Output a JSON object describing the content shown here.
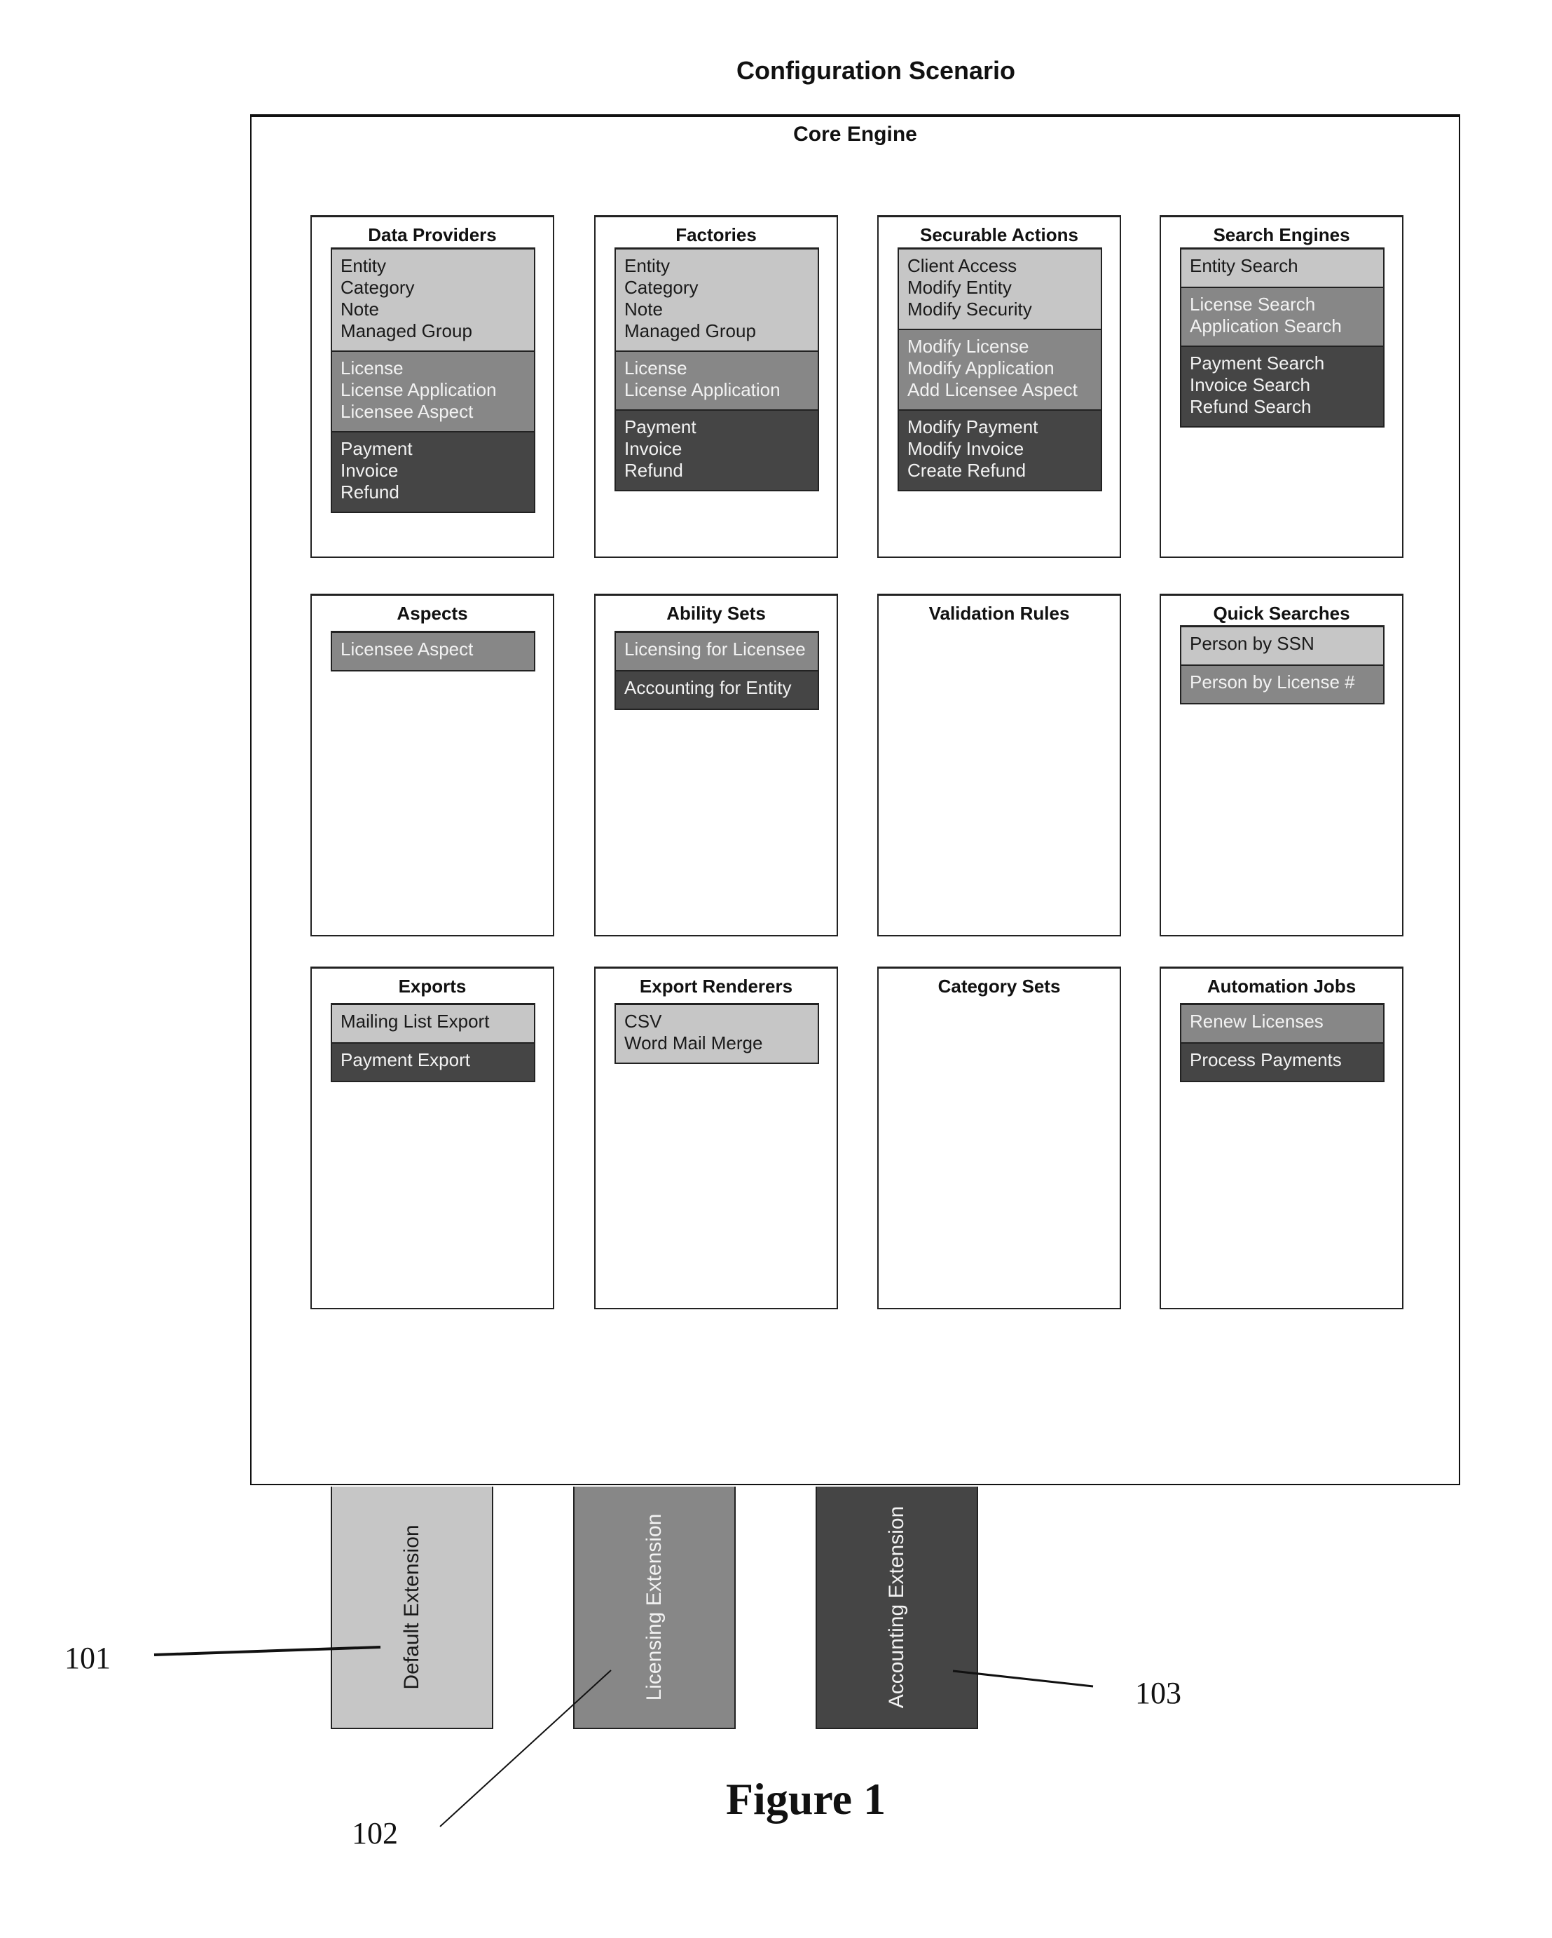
{
  "title": "Configuration Scenario",
  "core_engine": {
    "title": "Core Engine",
    "panels": [
      {
        "title": "Data Providers",
        "sections": [
          {
            "shade": "light",
            "items": [
              "Entity",
              "Category",
              "Note",
              "Managed Group"
            ]
          },
          {
            "shade": "mid",
            "items": [
              "License",
              "License Application",
              "Licensee Aspect"
            ]
          },
          {
            "shade": "dark",
            "items": [
              "Payment",
              "Invoice",
              "Refund"
            ]
          }
        ]
      },
      {
        "title": "Factories",
        "sections": [
          {
            "shade": "light",
            "items": [
              "Entity",
              "Category",
              "Note",
              "Managed Group"
            ]
          },
          {
            "shade": "mid",
            "items": [
              "License",
              "License Application"
            ]
          },
          {
            "shade": "dark",
            "items": [
              "Payment",
              "Invoice",
              "Refund"
            ]
          }
        ]
      },
      {
        "title": "Securable Actions",
        "sections": [
          {
            "shade": "light",
            "items": [
              "Client Access",
              "Modify Entity",
              "Modify Security"
            ]
          },
          {
            "shade": "mid",
            "items": [
              "Modify License",
              "Modify Application",
              "Add Licensee Aspect"
            ]
          },
          {
            "shade": "dark",
            "items": [
              "Modify Payment",
              "Modify Invoice",
              "Create Refund"
            ]
          }
        ]
      },
      {
        "title": "Search Engines",
        "sections": [
          {
            "shade": "light",
            "items": [
              "Entity Search"
            ]
          },
          {
            "shade": "mid",
            "items": [
              "License Search",
              "Application Search"
            ]
          },
          {
            "shade": "dark",
            "items": [
              "Payment Search",
              "Invoice Search",
              "Refund Search"
            ]
          }
        ]
      },
      {
        "title": "Aspects",
        "sections": [
          {
            "shade": "mid",
            "items": [
              "Licensee Aspect"
            ]
          }
        ]
      },
      {
        "title": "Ability Sets",
        "sections": [
          {
            "shade": "mid",
            "items": [
              "Licensing for Licensee"
            ]
          },
          {
            "shade": "dark",
            "items": [
              "Accounting for Entity"
            ]
          }
        ]
      },
      {
        "title": "Validation Rules",
        "sections": []
      },
      {
        "title": "Quick Searches",
        "sections": [
          {
            "shade": "light",
            "items": [
              "Person by SSN"
            ]
          },
          {
            "shade": "mid",
            "items": [
              "Person by License #"
            ]
          }
        ]
      },
      {
        "title": "Exports",
        "sections": [
          {
            "shade": "light",
            "items": [
              "Mailing List Export"
            ]
          },
          {
            "shade": "dark",
            "items": [
              "Payment Export"
            ]
          }
        ]
      },
      {
        "title": "Export Renderers",
        "sections": [
          {
            "shade": "light",
            "items": [
              "CSV",
              "Word Mail Merge"
            ]
          }
        ]
      },
      {
        "title": "Category Sets",
        "sections": []
      },
      {
        "title": "Automation Jobs",
        "sections": [
          {
            "shade": "mid",
            "items": [
              "Renew Licenses"
            ]
          },
          {
            "shade": "dark",
            "items": [
              "Process Payments"
            ]
          }
        ]
      }
    ]
  },
  "extensions": [
    {
      "label": "Default Extension",
      "shade": "light",
      "ref": "101"
    },
    {
      "label": "Licensing Extension",
      "shade": "mid",
      "ref": "102"
    },
    {
      "label": "Accounting Extension",
      "shade": "dark",
      "ref": "103"
    }
  ],
  "shades": {
    "light": "#c6c6c6",
    "mid": "#878787",
    "dark": "#454545"
  },
  "caption": "Figure 1"
}
